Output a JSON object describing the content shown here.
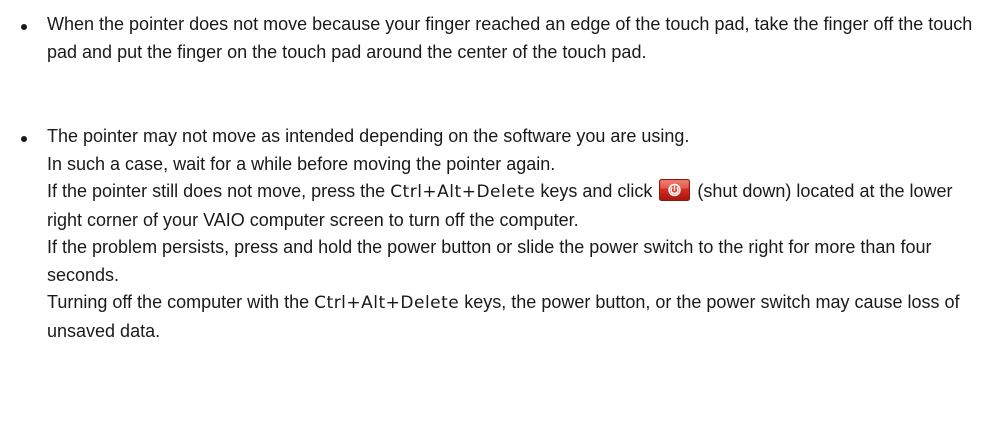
{
  "bullets": [
    {
      "text": "When the pointer does not move because your finger reached an edge of the touch pad, take the finger off the touch pad and put the finger on the touch pad around the center of the touch pad."
    },
    {
      "p1": "The pointer may not move as intended depending on the software you are using.",
      "p2": "In such a case, wait for a while before moving the pointer again.",
      "p3_pre": "If the pointer still does not move, press the ",
      "p3_keys": "Ctrl+Alt+Delete",
      "p3_mid": " keys and click ",
      "p3_post": " (shut down) located at the lower right corner of your VAIO computer screen to turn off the computer.",
      "p4": "If the problem persists, press and hold the power button or slide the power switch to the right for more than four seconds.",
      "p5_pre": "Turning off the computer with the ",
      "p5_keys": "Ctrl+Alt+Delete",
      "p5_post": " keys, the power button, or the power switch may cause loss of unsaved data."
    }
  ],
  "icons": {
    "shutdown": "shutdown-icon",
    "shutdown_bg": "#d42a1f",
    "shutdown_symbol": "#ffffff"
  }
}
